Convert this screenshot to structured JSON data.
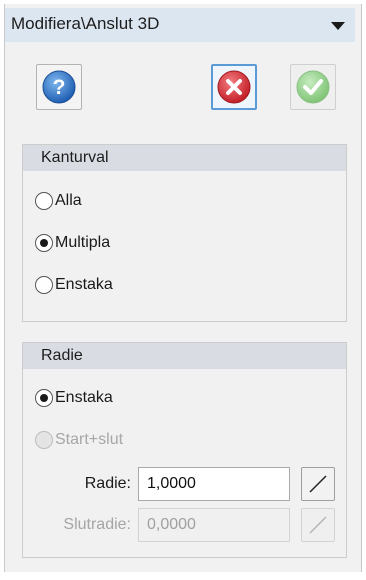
{
  "title": "Modifiera\\Anslut 3D",
  "toolbar": {
    "help_icon": "question-icon",
    "cancel_icon": "red-x-icon",
    "ok_icon": "green-check-icon",
    "colors": {
      "help": "#2c6fc4",
      "cancel": "#d8333a",
      "ok": "#8fcf86",
      "focus_border": "#5b9bd5"
    }
  },
  "edge_group": {
    "header": "Kanturval",
    "options": [
      {
        "label": "Alla",
        "selected": false
      },
      {
        "label": "Multipla",
        "selected": true
      },
      {
        "label": "Enstaka",
        "selected": false
      }
    ]
  },
  "radius_group": {
    "header": "Radie",
    "options": [
      {
        "label": "Enstaka",
        "selected": true,
        "enabled": true
      },
      {
        "label": "Start+slut",
        "selected": false,
        "enabled": false
      }
    ],
    "radius": {
      "label": "Radie:",
      "value": "1,0000"
    },
    "end_radius": {
      "label": "Slutradie:",
      "value": "0,0000"
    }
  }
}
